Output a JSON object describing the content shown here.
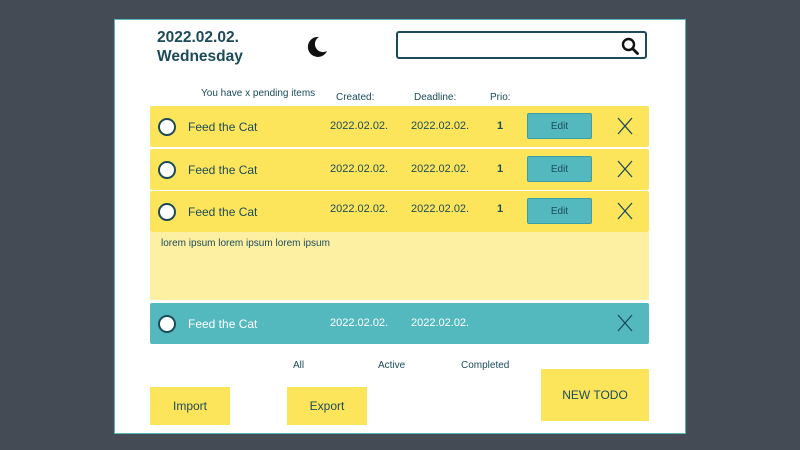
{
  "header": {
    "date": "2022.02.02.",
    "weekday": "Wednesday",
    "theme_icon": "moon-icon",
    "search": {
      "value": "",
      "placeholder": "",
      "icon": "search-icon"
    }
  },
  "columns": {
    "pending": "You have x pending items",
    "created": "Created:",
    "deadline": "Deadline:",
    "prio": "Prio:"
  },
  "todos": [
    {
      "title": "Feed the Cat",
      "created": "2022.02.02.",
      "deadline": "2022.02.02.",
      "prio": "1",
      "edit_label": "Edit",
      "state": "active"
    },
    {
      "title": "Feed the Cat",
      "created": "2022.02.02.",
      "deadline": "2022.02.02.",
      "prio": "1",
      "edit_label": "Edit",
      "state": "active"
    },
    {
      "title": "Feed the Cat",
      "created": "2022.02.02.",
      "deadline": "2022.02.02.",
      "prio": "1",
      "edit_label": "Edit",
      "state": "expanded",
      "description": "lorem ipsum lorem ipsum lorem ipsum"
    },
    {
      "title": "Feed the Cat",
      "created": "2022.02.02.",
      "deadline": "2022.02.02.",
      "state": "completed"
    }
  ],
  "filters": {
    "all": "All",
    "active": "Active",
    "completed": "Completed"
  },
  "actions": {
    "import": "Import",
    "export": "Export",
    "new_todo": "NEW TODO"
  },
  "colors": {
    "background": "#444b55",
    "card": "#ffffff",
    "text": "#1b4b5a",
    "row_active": "#fde55b",
    "row_completed": "#54b9bf",
    "description": "#fdf0a2",
    "button": "#fde55b"
  }
}
